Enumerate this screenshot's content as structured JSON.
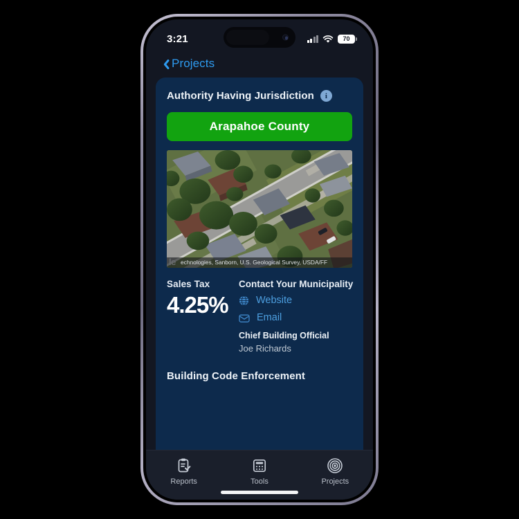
{
  "statusbar": {
    "time": "3:21",
    "signal_icon": "cellular-signal-icon",
    "wifi_icon": "wifi-icon",
    "battery_level": "70",
    "battery_icon": "battery-icon"
  },
  "navigation": {
    "back_icon": "chevron-left-icon",
    "back_label": "Projects"
  },
  "card": {
    "title": "Authority Having Jurisdiction",
    "info_icon": "info-circle-icon",
    "info_glyph": "i",
    "ahj_button_label": "Arapahoe County",
    "ahj_button_color": "#12a310",
    "map": {
      "logo_text": "le",
      "attribution": "echnologies, Sanborn, U.S. Geological Survey, USDA/FF"
    },
    "sales_tax": {
      "label": "Sales Tax",
      "value": "4.25%"
    },
    "contact": {
      "title": "Contact Your Municipality",
      "links": [
        {
          "label": "Website",
          "icon": "globe-icon"
        },
        {
          "label": "Email",
          "icon": "envelope-icon"
        }
      ],
      "official_role": "Chief Building Official",
      "official_name": "Joe Richards"
    },
    "building_code_section": "Building Code Enforcement"
  },
  "tabbar": {
    "items": [
      {
        "label": "Reports",
        "icon": "clipboard-check-icon"
      },
      {
        "label": "Tools",
        "icon": "calculator-icon"
      },
      {
        "label": "Projects",
        "icon": "target-rings-icon"
      }
    ]
  }
}
